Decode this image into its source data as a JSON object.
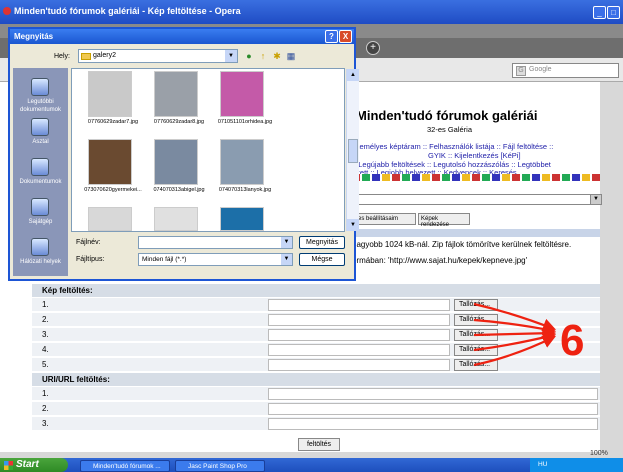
{
  "browser": {
    "title": "Minden'tudó fórumok galériái - Kép feltöltése - Opera",
    "search_placeholder": "Google",
    "search_icon_text": "G",
    "new_tab_symbol": "+",
    "zoom": "100%",
    "minimize": "_",
    "restore": "□"
  },
  "page": {
    "title": "Minden'tudó fórumok galériái",
    "subtitle": "32-es Galéria",
    "nav_line1": "személyes képtáram :: Felhasználók listája :: Fájl feltöltése ::",
    "nav_line2": "GYIK :: Kijelentkezés [KéPi]",
    "nav_line3": ":: Legújabb feltöltések :: Legutolsó hozzászólás :: Legtöbbet",
    "nav_line4": "ezett :: Legjobb helyezett :: Kedvencek :: Keresés",
    "btn_album_settings": "yes beállításaim",
    "btn_sort_images": "Képek rendezése",
    "info1": "nagyobb 1024 kB-nál. Zip fájlok tömörítve kerülnek feltöltésre.",
    "info2": "ormában: 'http://www.sajat.hu/kepek/kepneve.jpg'",
    "upload_section": "Kép feltöltés:",
    "url_section": "URI/URL feltöltés:",
    "browse_label": "Tallózás...",
    "upload_rows": [
      "1.",
      "2.",
      "3.",
      "4.",
      "5."
    ],
    "url_rows": [
      "1.",
      "2.",
      "3."
    ],
    "submit_label": "feltöltés",
    "annotation_number": "6"
  },
  "dialog": {
    "title": "Megnyitás",
    "lookin_label": "Hely:",
    "lookin_value": "galery2",
    "help_symbol": "?",
    "close_symbol": "X",
    "places": [
      "Legutóbbi dokumentumok",
      "Asztal",
      "Dokumentumok",
      "Sajátgép",
      "Hálózati helyek"
    ],
    "files": [
      {
        "name": "07760629zadar7.jpg",
        "color": "#c9c9c9"
      },
      {
        "name": "07760629zadar8.jpg",
        "color": "#9aa0a8"
      },
      {
        "name": "071051101orhidea.jpg",
        "color": "#c45aa8"
      },
      {
        "name": "073070620gyermekei...",
        "color": "#6a4a30"
      },
      {
        "name": "074070313abigel.jpg",
        "color": "#7a8aa0"
      },
      {
        "name": "074070313lanyok.jpg",
        "color": "#8a9cb0"
      }
    ],
    "filename_label": "Fájlnév:",
    "filetype_label": "Fájltípus:",
    "filetype_value": "Minden fájl (*.*)",
    "open_button": "Megnyitás",
    "cancel_button": "Mégse"
  },
  "taskbar": {
    "start": "Start",
    "tasks": [
      "Minden'tudó fórumok ...",
      "Jasc Paint Shop Pro"
    ],
    "tray_text": "HU"
  }
}
